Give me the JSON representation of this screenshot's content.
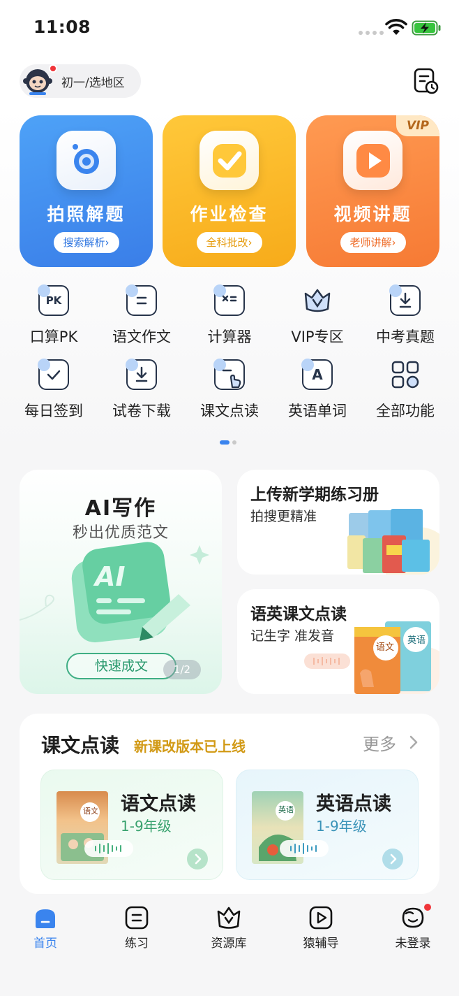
{
  "status_bar": {
    "time": "11:08"
  },
  "header": {
    "region_label": "初一/选地区"
  },
  "main_cards": [
    {
      "title": "拍照解题",
      "subtitle": "搜索解析›",
      "icon": "camera-icon"
    },
    {
      "title": "作业检查",
      "subtitle": "全科批改›",
      "icon": "checkmark-icon"
    },
    {
      "title": "视频讲题",
      "subtitle": "老师讲解›",
      "icon": "play-icon",
      "badge": "VIP"
    }
  ],
  "functions": [
    {
      "label": "口算PK",
      "icon": "pk-icon",
      "glyph": "PK"
    },
    {
      "label": "语文作文",
      "icon": "essay-icon",
      "glyph": ""
    },
    {
      "label": "计算器",
      "icon": "calculator-icon",
      "glyph": ""
    },
    {
      "label": "VIP专区",
      "icon": "vip-crown-icon",
      "glyph": ""
    },
    {
      "label": "中考真题",
      "icon": "download-icon",
      "glyph": ""
    },
    {
      "label": "每日签到",
      "icon": "calendar-check-icon",
      "glyph": ""
    },
    {
      "label": "试卷下载",
      "icon": "paper-download-icon",
      "glyph": ""
    },
    {
      "label": "课文点读",
      "icon": "touch-read-icon",
      "glyph": ""
    },
    {
      "label": "英语单词",
      "icon": "letter-a-icon",
      "glyph": "A"
    },
    {
      "label": "全部功能",
      "icon": "grid-icon",
      "glyph": ""
    }
  ],
  "promos": {
    "ai": {
      "title": "AI写作",
      "subtitle": "秒出优质范文",
      "button": "快速成文",
      "page": "1/2"
    },
    "workbook": {
      "title": "上传新学期练习册",
      "subtitle": "拍搜更精准"
    },
    "reading": {
      "title": "语英课文点读",
      "subtitle": "记生字 准发音"
    }
  },
  "section": {
    "title": "课文点读",
    "tag": "新课改版本已上线",
    "more": "更多",
    "cards": [
      {
        "title": "语文点读",
        "subtitle": "1-9年级",
        "book_label": "语文"
      },
      {
        "title": "英语点读",
        "subtitle": "1-9年级",
        "book_label": "英语"
      }
    ]
  },
  "tabs": [
    {
      "label": "首页",
      "active": true
    },
    {
      "label": "练习",
      "active": false
    },
    {
      "label": "资源库",
      "active": false
    },
    {
      "label": "猿辅导",
      "active": false
    },
    {
      "label": "未登录",
      "active": false
    }
  ],
  "colors": {
    "accent_blue": "#3a84ee",
    "accent_orange": "#f67a34",
    "accent_yellow": "#f7ab1a",
    "accent_green": "#3fae84"
  }
}
